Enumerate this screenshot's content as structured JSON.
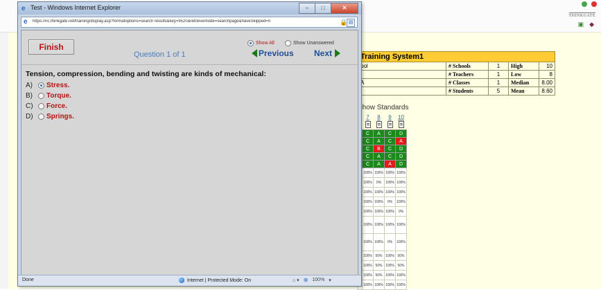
{
  "popup": {
    "title": "Test - Windows Internet Explorer",
    "url": "https://nc.thinkgate.net/training/display.asp?formatoptions=search results&key=9520&retrievemode=searchpage&haveSkipped=n",
    "status_text": "Done",
    "zone_text": "Internet | Protected Mode: On",
    "zoom_text": "100%"
  },
  "test": {
    "finish_label": "Finish",
    "question_counter": "Question 1 of 1",
    "show_all_label": "Show All",
    "show_unanswered_label": "Show Unanswered",
    "previous_label": "Previous",
    "next_label": "Next",
    "question_text": "Tension, compression, bending and twisting are kinds of mechanical:",
    "answers": [
      {
        "letter": "A)",
        "text": "Stress.",
        "selected": true
      },
      {
        "letter": "B)",
        "text": "Torque.",
        "selected": false
      },
      {
        "letter": "C)",
        "text": "Force.",
        "selected": false
      },
      {
        "letter": "D)",
        "text": "Springs.",
        "selected": false
      }
    ]
  },
  "background": {
    "logo_text": "THINKGATE",
    "table_title": "Training System1",
    "left_cells": [
      "ool",
      "",
      "A",
      ""
    ],
    "stats": [
      {
        "label": "# Schools",
        "count": "1",
        "metric": "High",
        "value": "10"
      },
      {
        "label": "# Teachers",
        "count": "1",
        "metric": "Low",
        "value": "8"
      },
      {
        "label": "# Classes",
        "count": "1",
        "metric": "Median",
        "value": "8.00"
      },
      {
        "label": "# Students",
        "count": "5",
        "metric": "Mean",
        "value": "8.60"
      }
    ],
    "show_standards_label": "Show Standards",
    "grid_headers": [
      "",
      "7",
      "8",
      "9",
      "10"
    ],
    "grade_rows": [
      [
        "",
        "C",
        "A",
        "C",
        "D"
      ],
      [
        "",
        "C",
        "A",
        "C",
        "A"
      ],
      [
        "",
        "C",
        "B",
        "C",
        "D"
      ],
      [
        "",
        "C",
        "A",
        "C",
        "D"
      ],
      [
        "",
        "C",
        "A",
        "A",
        "D"
      ]
    ],
    "pct_rows": [
      [
        "%",
        "100%",
        "100%",
        "100%",
        "100%"
      ],
      [
        "%",
        "100%",
        "0%",
        "100%",
        "100%"
      ],
      [
        "%",
        "100%",
        "100%",
        "100%",
        "100%"
      ],
      [
        "%",
        "100%",
        "100%",
        "0%",
        "100%"
      ],
      [
        "%",
        "100%",
        "100%",
        "100%",
        "0%"
      ],
      [
        "",
        "100%",
        "100%",
        "100%",
        "100%"
      ],
      [
        "%",
        "100%",
        "100%",
        "0%",
        "100%"
      ],
      [
        "%",
        "100%",
        "50%",
        "100%",
        "50%"
      ],
      [
        "%",
        "100%",
        "50%",
        "100%",
        "50%"
      ],
      [
        "%",
        "100%",
        "50%",
        "100%",
        "100%"
      ],
      [
        "",
        "100%",
        "100%",
        "100%",
        "100%"
      ]
    ]
  },
  "colors": {
    "grade_green": "#1a8a1a",
    "grade_red": "#e11b1b",
    "accent_red": "#b31313",
    "header_gold": "#ffcc33"
  }
}
